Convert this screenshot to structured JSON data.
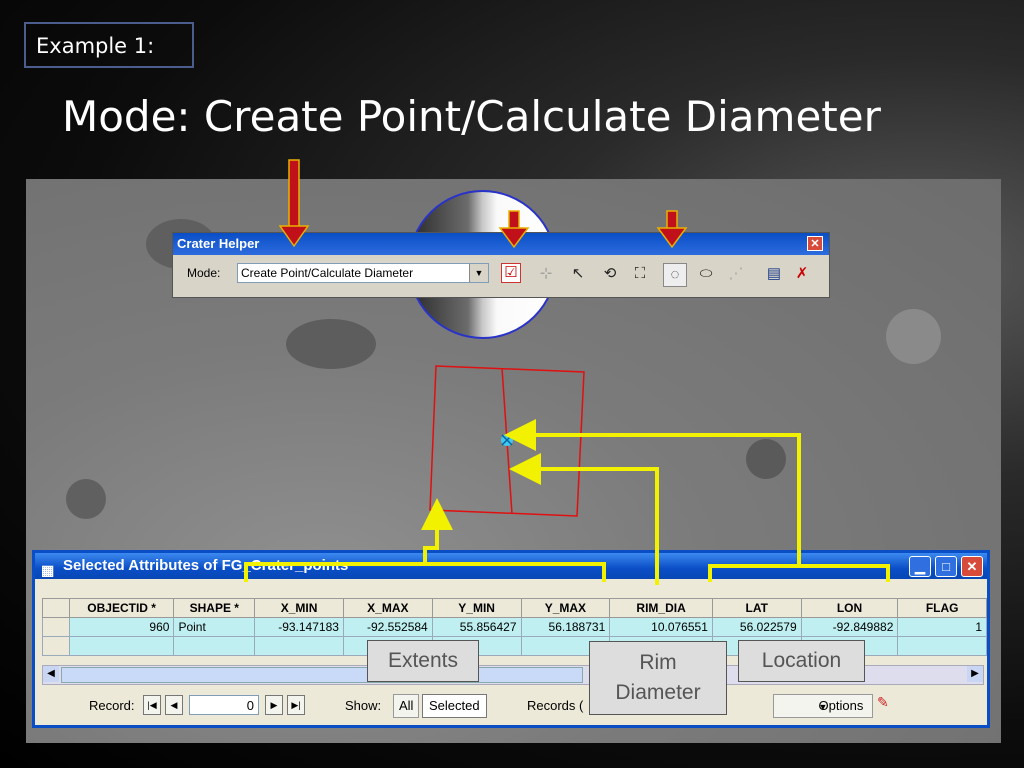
{
  "slide": {
    "example_label": "Example 1:",
    "title": "Mode: Create Point/Calculate Diameter"
  },
  "toolbar": {
    "title": "Crater Helper",
    "mode_label": "Mode:",
    "mode_value": "Create Point/Calculate Diameter",
    "icons": [
      "check-select-icon",
      "create-point-icon",
      "select-point-icon",
      "rotate-icon",
      "polygon-icon",
      "crater-circle-icon",
      "ellipse-icon",
      "multi-point-icon",
      "edit-table-icon",
      "delete-icon"
    ]
  },
  "attributes": {
    "title": "Selected Attributes of FG_Crater_points",
    "columns": [
      "OBJECTID *",
      "SHAPE *",
      "X_MIN",
      "X_MAX",
      "Y_MIN",
      "Y_MAX",
      "RIM_DIA",
      "LAT",
      "LON",
      "FLAG"
    ],
    "rows": [
      [
        "960",
        "Point",
        "-93.147183",
        "-92.552584",
        "55.856427",
        "56.188731",
        "10.076551",
        "56.022579",
        "-92.849882",
        "1"
      ]
    ],
    "record_label": "Record:",
    "record_value": "0",
    "show_label": "Show:",
    "show_all": "All",
    "show_selected": "Selected",
    "records_label": "Records (",
    "options_label": "Options"
  },
  "callouts": {
    "extents": "Extents",
    "rim_diameter_line1": "Rim",
    "rim_diameter_line2": "Diameter",
    "location": "Location"
  },
  "colors": {
    "arrow_red": "#c0101a",
    "arrow_border": "#e8b000",
    "callout_yellow": "#f2f200",
    "title_bar_blue": "#0a4ec6"
  }
}
